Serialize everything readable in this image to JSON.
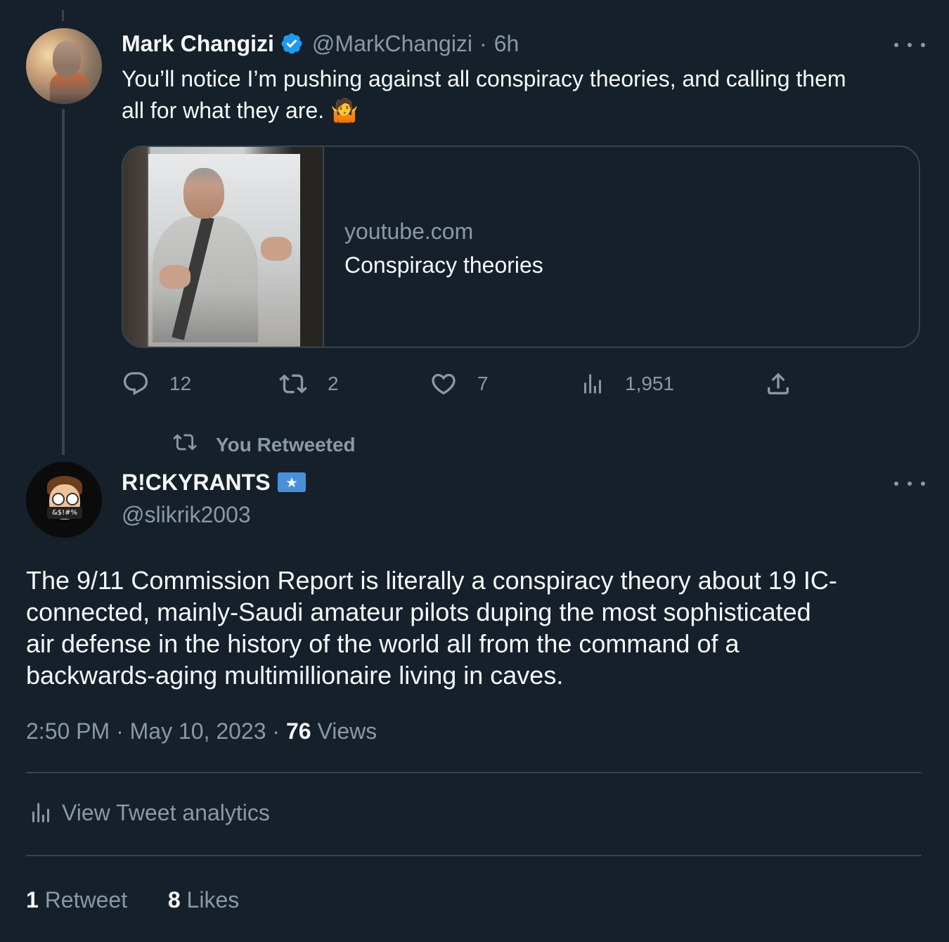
{
  "tweet1": {
    "author_name": "Mark Changizi",
    "handle": "@MarkChangizi",
    "separator": "·",
    "time": "6h",
    "text_line1": "You’ll notice I’m pushing against all conspiracy theories, and calling them",
    "text_line2": "all for what they are. 🤷",
    "link_card": {
      "domain": "youtube.com",
      "title": "Conspiracy theories"
    },
    "actions": {
      "replies": "12",
      "retweets": "2",
      "likes": "7",
      "views": "1,951"
    }
  },
  "retweet_context": {
    "label": "You Retweeted"
  },
  "tweet2": {
    "author_name": "R!CKYRANTS",
    "handle": "@slikrik2003",
    "avatar_mask_text": "&$!#%",
    "text_lines": [
      "The 9/11 Commission Report is literally a conspiracy theory about 19 IC-",
      "connected, mainly-Saudi amateur pilots duping the most sophisticated",
      "air defense in the history of the world all from the command of a",
      "backwards-aging multimillionaire living in caves."
    ],
    "timestamp_time": "2:50 PM",
    "timestamp_date": "May 10, 2023",
    "views_count": "76",
    "views_label": "Views",
    "analytics_label": "View Tweet analytics",
    "retweet_count": "1",
    "retweet_label": "Retweet",
    "likes_count": "8",
    "likes_label": "Likes"
  },
  "colors": {
    "background": "#15202b",
    "text": "#f7f9f9",
    "muted": "#8b98a5",
    "border": "#38444d",
    "verified_blue": "#1d9bf0"
  },
  "icons": [
    "verified-badge-icon",
    "more-icon",
    "reply-icon",
    "retweet-icon",
    "like-icon",
    "views-icon",
    "share-icon",
    "analytics-icon",
    "star-badge-icon"
  ]
}
